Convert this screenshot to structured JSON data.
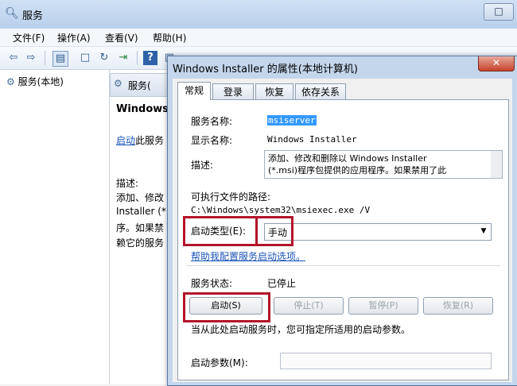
{
  "window": {
    "title": "服务",
    "title_icon": "search-icon"
  },
  "menu": [
    "文件(F)",
    "操作(A)",
    "查看(V)",
    "帮助(H)"
  ],
  "toolbar_icons": [
    "back-arrow-icon",
    "forward-arrow-icon",
    "console-tree-icon",
    "properties-icon",
    "refresh-icon",
    "export-icon",
    "help-icon",
    "panel-icon",
    "play-icon",
    "stop-icon",
    "pause-icon",
    "restart-icon"
  ],
  "left_pane": {
    "node_label": "服务(本地)"
  },
  "right_pane": {
    "header_label": "服务(",
    "service_name_partial": "Windows",
    "start_link": "启动",
    "start_suffix": "此服务",
    "desc_label": "描述:",
    "desc_lines": [
      "添加、修改",
      "Installer (*",
      "序。如果禁",
      "赖它的服务"
    ]
  },
  "dialog": {
    "title": "Windows Installer 的属性(本地计算机)",
    "close_glyph": "✕",
    "tabs": [
      "常规",
      "登录",
      "恢复",
      "依存关系"
    ],
    "service_name_label": "服务名称:",
    "service_name_value": "msiserver",
    "display_name_label": "显示名称:",
    "display_name_value": "Windows Installer",
    "description_label": "描述:",
    "description_line1": "添加、修改和删除以 Windows Installer",
    "description_line2": "(*.msi)程序包提供的应用程序。如果禁用了此",
    "exe_path_label": "可执行文件的路径:",
    "exe_path_value": "C:\\Windows\\system32\\msiexec.exe /V",
    "startup_type_label": "启动类型(E):",
    "startup_type_value": "手动",
    "help_link": "帮助我配置服务启动选项。",
    "status_label": "服务状态:",
    "status_value": "已停止",
    "btn_start": "启动(S)",
    "btn_stop": "停止(T)",
    "btn_pause": "暂停(P)",
    "btn_resume": "恢复(R)",
    "start_params_hint": "当从此处启动服务时，您可指定所适用的启动参数。",
    "start_params_label": "启动参数(M):",
    "start_params_value": ""
  },
  "colors": {
    "highlight_box": "#b3142a",
    "link": "#1a55b8",
    "selection": "#3399ff"
  }
}
